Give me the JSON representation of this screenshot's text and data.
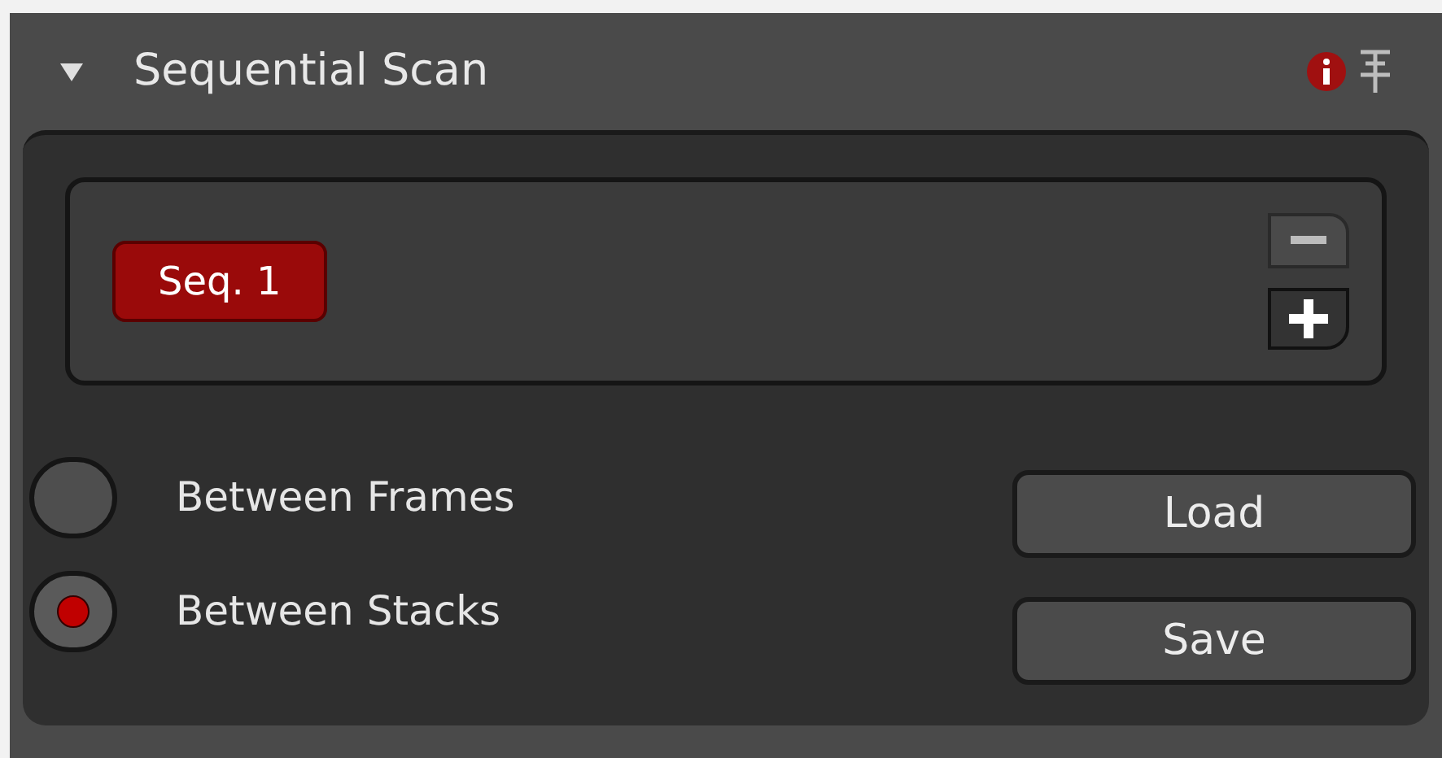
{
  "panel": {
    "title": "Sequential Scan",
    "expanded": true
  },
  "sequences": [
    {
      "label": "Seq. 1",
      "selected": true
    }
  ],
  "scan_modes": [
    {
      "label": "Between Frames",
      "selected": false
    },
    {
      "label": "Between Stacks",
      "selected": true
    }
  ],
  "buttons": [
    "Load",
    "Save"
  ]
}
